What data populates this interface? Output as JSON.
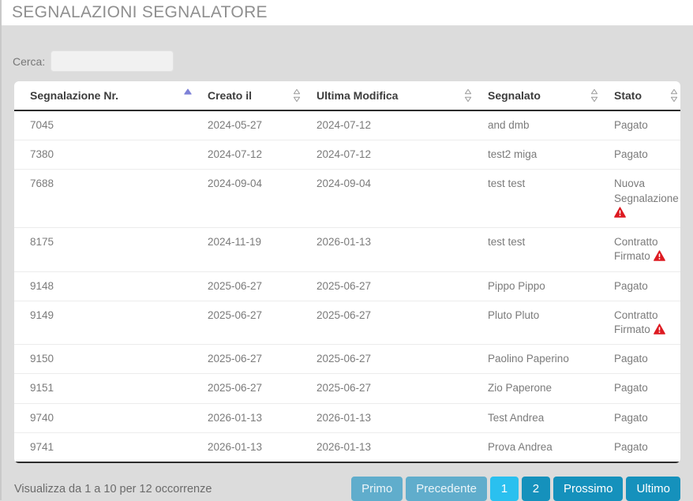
{
  "page": {
    "title": "SEGNALAZIONI SEGNALATORE"
  },
  "search": {
    "label": "Cerca:",
    "value": "",
    "placeholder": ""
  },
  "table": {
    "columns": [
      {
        "label": "Segnalazione Nr.",
        "sort": "asc"
      },
      {
        "label": "Creato il",
        "sort": "none"
      },
      {
        "label": "Ultima Modifica",
        "sort": "none"
      },
      {
        "label": "Segnalato",
        "sort": "none"
      },
      {
        "label": "Stato",
        "sort": "none"
      }
    ],
    "rows": [
      {
        "nr": "7045",
        "creato": "2024-05-27",
        "modifica": "2024-07-12",
        "segnalato": "and dmb",
        "stato": "Pagato",
        "warning": false
      },
      {
        "nr": "7380",
        "creato": "2024-07-12",
        "modifica": "2024-07-12",
        "segnalato": "test2 miga",
        "stato": "Pagato",
        "warning": false
      },
      {
        "nr": "7688",
        "creato": "2024-09-04",
        "modifica": "2024-09-04",
        "segnalato": "test test",
        "stato": "Nuova Segnalazione",
        "warning": true
      },
      {
        "nr": "8175",
        "creato": "2024-11-19",
        "modifica": "2026-01-13",
        "segnalato": "test test",
        "stato": "Contratto Firmato",
        "warning": true
      },
      {
        "nr": "9148",
        "creato": "2025-06-27",
        "modifica": "2025-06-27",
        "segnalato": "Pippo Pippo",
        "stato": "Pagato",
        "warning": false
      },
      {
        "nr": "9149",
        "creato": "2025-06-27",
        "modifica": "2025-06-27",
        "segnalato": "Pluto Pluto",
        "stato": "Contratto Firmato",
        "warning": true
      },
      {
        "nr": "9150",
        "creato": "2025-06-27",
        "modifica": "2025-06-27",
        "segnalato": "Paolino Paperino",
        "stato": "Pagato",
        "warning": false
      },
      {
        "nr": "9151",
        "creato": "2025-06-27",
        "modifica": "2025-06-27",
        "segnalato": "Zio Paperone",
        "stato": "Pagato",
        "warning": false
      },
      {
        "nr": "9740",
        "creato": "2026-01-13",
        "modifica": "2026-01-13",
        "segnalato": "Test Andrea",
        "stato": "Pagato",
        "warning": false
      },
      {
        "nr": "9741",
        "creato": "2026-01-13",
        "modifica": "2026-01-13",
        "segnalato": "Prova Andrea",
        "stato": "Pagato",
        "warning": false
      }
    ],
    "warning_icon": "warning-triangle"
  },
  "footer": {
    "info": "Visualizza da 1 a 10 per 12 occorrenze",
    "pagination": [
      {
        "label": "Primo",
        "state": "disabled"
      },
      {
        "label": "Precedente",
        "state": "disabled"
      },
      {
        "label": "1",
        "state": "active"
      },
      {
        "label": "2",
        "state": "normal"
      },
      {
        "label": "Prossimo",
        "state": "normal"
      },
      {
        "label": "Ultimo",
        "state": "normal"
      }
    ]
  },
  "colors": {
    "page_bg": "#dcdcdc",
    "pagination_normal": "#1591bc",
    "pagination_active": "#2ac0ef",
    "pagination_disabled": "#60adcc",
    "sort_active": "#7d81d7",
    "warning_red": "#dd1a21"
  }
}
